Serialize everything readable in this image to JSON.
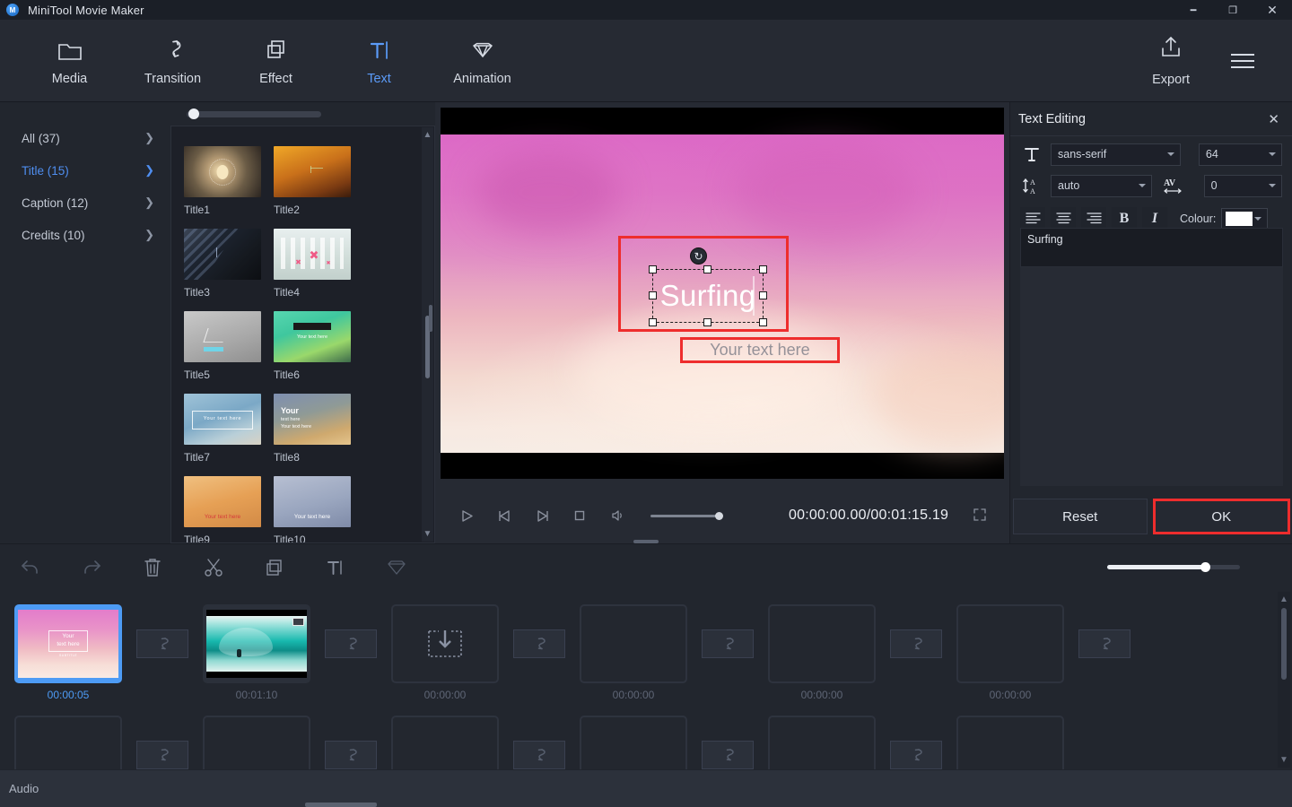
{
  "titlebar": {
    "app_title": "MiniTool Movie Maker",
    "logo_letter": "M",
    "minimize": "—",
    "maximize": "❐",
    "close": "✕"
  },
  "ribbon": {
    "tabs": [
      {
        "label": "Media",
        "icon": "folder-icon",
        "active": false
      },
      {
        "label": "Transition",
        "icon": "transition-icon",
        "active": false
      },
      {
        "label": "Effect",
        "icon": "effect-icon",
        "active": false
      },
      {
        "label": "Text",
        "icon": "text-icon",
        "active": true
      },
      {
        "label": "Animation",
        "icon": "diamond-icon",
        "active": false
      }
    ],
    "export_label": "Export",
    "active_color": "#5b9bf8"
  },
  "categories": [
    {
      "label": "All (37)",
      "active": false
    },
    {
      "label": "Title (15)",
      "active": true
    },
    {
      "label": "Caption (12)",
      "active": false
    },
    {
      "label": "Credits (10)",
      "active": false
    }
  ],
  "templates": [
    {
      "name": "Title1",
      "style": "t1",
      "caption": ""
    },
    {
      "name": "Title2",
      "style": "t2",
      "caption": ""
    },
    {
      "name": "Title3",
      "style": "t3",
      "caption": ""
    },
    {
      "name": "Title4",
      "style": "t4",
      "caption": ""
    },
    {
      "name": "Title5",
      "style": "t5",
      "caption": ""
    },
    {
      "name": "Title6",
      "style": "t6",
      "caption": "Your text here"
    },
    {
      "name": "Title7",
      "style": "t7",
      "caption": "Your text here"
    },
    {
      "name": "Title8",
      "style": "t8",
      "caption": "Your\ntext here\nYour text here"
    },
    {
      "name": "Title9",
      "style": "t9",
      "caption": "Your text here"
    },
    {
      "name": "Title10",
      "style": "t10",
      "caption": "Your text here"
    }
  ],
  "preview": {
    "selected_text": "Surfing",
    "placeholder_text": "Your text here",
    "rotate_icon": "rotate-icon",
    "highlight_color": "#ee2d2d",
    "timecode": "00:00:00.00/00:01:15.19",
    "controls": {
      "play": "▷",
      "prev_frame": "◁",
      "next_frame": "▷",
      "stop": "□",
      "volume": "volume-icon",
      "fullscreen": "fullscreen-icon"
    }
  },
  "text_editing": {
    "title": "Text Editing",
    "close": "✕",
    "font_family": "sans-serif",
    "font_size": "64",
    "line_spacing": "auto",
    "letter_spacing": "0",
    "colour_label": "Colour:",
    "colour_value": "#ffffff",
    "bold_label": "B",
    "italic_label": "I",
    "text_value": "Surfing",
    "reset_label": "Reset",
    "ok_label": "OK"
  },
  "edit_toolbar": {
    "buttons": [
      {
        "name": "undo-button",
        "icon": "undo-icon",
        "dim": true
      },
      {
        "name": "redo-button",
        "icon": "redo-icon",
        "dim": true
      },
      {
        "name": "delete-button",
        "icon": "trash-icon",
        "dim": false
      },
      {
        "name": "split-button",
        "icon": "scissors-icon",
        "dim": false
      },
      {
        "name": "copy-button",
        "icon": "copy-icon",
        "dim": false
      },
      {
        "name": "text-button",
        "icon": "text-icon",
        "dim": false
      },
      {
        "name": "effect-button",
        "icon": "diamond-icon",
        "dim": true
      }
    ],
    "zoom_percent": 72
  },
  "timeline": {
    "track1": [
      {
        "type": "clip",
        "time": "00:00:05",
        "selected": true,
        "style": "pink-title",
        "caption": "Your\ntext here"
      },
      {
        "type": "clip",
        "time": "00:01:10",
        "selected": false,
        "style": "wave",
        "caption": ""
      },
      {
        "type": "clip",
        "time": "00:00:00",
        "selected": false,
        "style": "import",
        "caption": ""
      },
      {
        "type": "clip",
        "time": "00:00:00",
        "selected": false,
        "style": "empty",
        "caption": ""
      },
      {
        "type": "clip",
        "time": "00:00:00",
        "selected": false,
        "style": "empty",
        "caption": ""
      },
      {
        "type": "clip",
        "time": "00:00:00",
        "selected": false,
        "style": "empty",
        "caption": ""
      }
    ],
    "track2": [
      {
        "type": "clip",
        "time": "",
        "selected": false,
        "style": "empty",
        "caption": ""
      },
      {
        "type": "clip",
        "time": "",
        "selected": false,
        "style": "empty",
        "caption": ""
      },
      {
        "type": "clip",
        "time": "",
        "selected": false,
        "style": "empty",
        "caption": ""
      },
      {
        "type": "clip",
        "time": "",
        "selected": false,
        "style": "empty",
        "caption": ""
      },
      {
        "type": "clip",
        "time": "",
        "selected": false,
        "style": "empty",
        "caption": ""
      },
      {
        "type": "clip",
        "time": "",
        "selected": false,
        "style": "empty",
        "caption": ""
      }
    ],
    "transition_icon": "transition-icon"
  },
  "audio": {
    "label": "Audio"
  }
}
